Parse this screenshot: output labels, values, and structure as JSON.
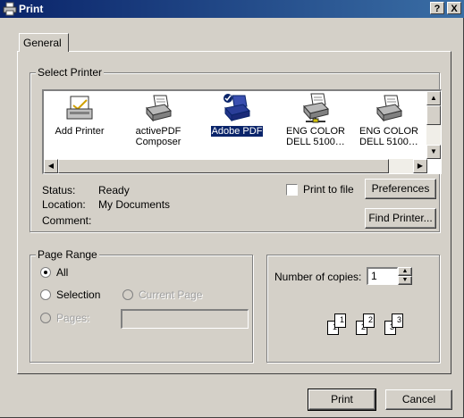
{
  "window": {
    "title": "Print",
    "help_label": "?",
    "close_label": "X"
  },
  "tabs": [
    {
      "label": "General"
    }
  ],
  "select_printer": {
    "legend": "Select Printer",
    "printers": [
      {
        "line1": "Add Printer",
        "line2": "",
        "icon": "add-printer-icon",
        "selected": false
      },
      {
        "line1": "activePDF",
        "line2": "Composer",
        "icon": "printer-icon",
        "selected": false
      },
      {
        "line1": "Adobe PDF",
        "line2": "",
        "icon": "printer-icon",
        "selected": true
      },
      {
        "line1": "ENG COLOR",
        "line2": "DELL 5100…",
        "icon": "network-printer-icon",
        "selected": false
      },
      {
        "line1": "ENG COLOR",
        "line2": "DELL 5100…",
        "icon": "printer-icon",
        "selected": false
      }
    ],
    "status_label": "Status:",
    "status_value": "Ready",
    "location_label": "Location:",
    "location_value": "My Documents",
    "comment_label": "Comment:",
    "comment_value": "",
    "print_to_file_label": "Print to file",
    "print_to_file_checked": false,
    "preferences_label": "Preferences",
    "find_printer_label": "Find Printer..."
  },
  "page_range": {
    "legend": "Page Range",
    "options": [
      {
        "label": "All",
        "selected": true,
        "enabled": true
      },
      {
        "label": "Selection",
        "selected": false,
        "enabled": true
      },
      {
        "label": "Current Page",
        "selected": false,
        "enabled": false
      },
      {
        "label": "Pages:",
        "selected": false,
        "enabled": false
      }
    ],
    "pages_value": ""
  },
  "copies": {
    "label": "Number of copies:",
    "value": "1",
    "collate_pages": [
      "1",
      "1",
      "2",
      "2",
      "3",
      "3"
    ]
  },
  "buttons": {
    "print_label": "Print",
    "cancel_label": "Cancel"
  },
  "colors": {
    "titlebar_start": "#0a246a",
    "titlebar_end": "#3a6ea5",
    "face": "#d4d0c8",
    "selection": "#0a246a"
  }
}
